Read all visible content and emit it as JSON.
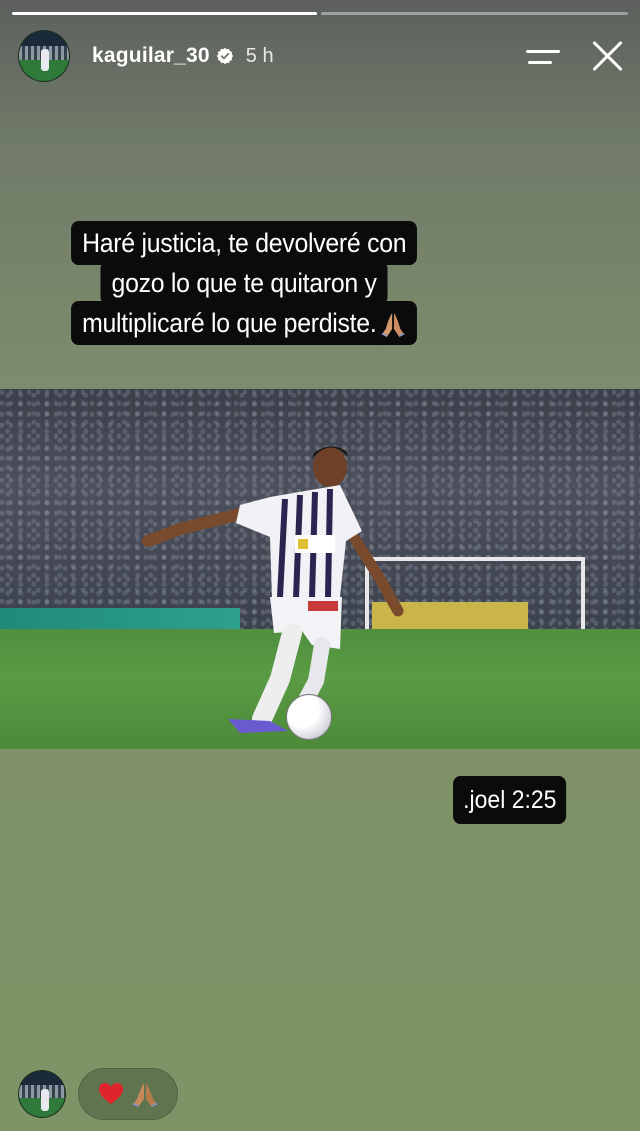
{
  "progress": {
    "segments": 2,
    "active_index": 0
  },
  "header": {
    "username": "kaguilar_30",
    "verified": true,
    "time_ago": "5 h",
    "icons": [
      "menu-icon",
      "close-icon"
    ]
  },
  "caption": {
    "lines": [
      "Haré justicia, te devolveré con",
      "gozo lo que te quitaron y",
      "multiplicaré lo que perdiste."
    ],
    "emoji": "pray-icon"
  },
  "verse": {
    "text": ".joel 2:25"
  },
  "footer": {
    "reactions": [
      "heart-icon",
      "pray-icon"
    ]
  },
  "colors": {
    "text": "#ffffff",
    "label_background": "#0b0b0b",
    "background_top": "#5d605d",
    "background_bottom": "#7e9466"
  }
}
